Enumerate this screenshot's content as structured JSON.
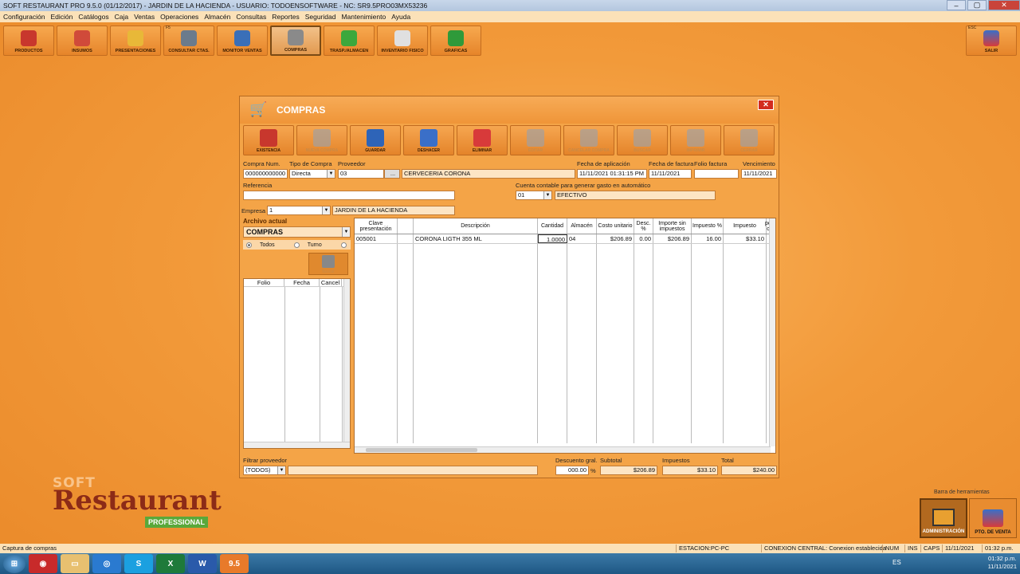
{
  "window": {
    "title": "SOFT RESTAURANT PRO 9.5.0 (01/12/2017)  -  JARDIN DE LA HACIENDA  -  USUARIO: TODOENSOFTWARE   -   NC: SR9.5PRO03MX53236"
  },
  "menu": [
    "Configuración",
    "Edición",
    "Catálogos",
    "Caja",
    "Ventas",
    "Operaciones",
    "Almacén",
    "Consultas",
    "Reportes",
    "Seguridad",
    "Mantenimiento",
    "Ayuda"
  ],
  "toolbar": [
    {
      "label": "PRODUCTOS",
      "icon": "products-icon",
      "color": "#c8372d"
    },
    {
      "label": "INSUMOS",
      "icon": "supplies-icon",
      "color": "#d04a3a"
    },
    {
      "label": "PRESENTACIONES",
      "icon": "beer-icon",
      "color": "#e8b838"
    },
    {
      "label": "CONSULTAR CTAS.",
      "icon": "phone-search-icon",
      "color": "#6b7b8c",
      "key": "F5"
    },
    {
      "label": "MONITOR VENTAS",
      "icon": "monitor-icon",
      "color": "#3a6fb8"
    },
    {
      "label": "COMPRAS",
      "icon": "cart-icon",
      "color": "#8a8a8a",
      "active": true
    },
    {
      "label": "TRASP./ALMACEN",
      "icon": "transfer-icon",
      "color": "#3ca83c"
    },
    {
      "label": "INVENTARIO FISICO",
      "icon": "clipboard-icon",
      "color": "#e0e0e0"
    },
    {
      "label": "GRAFICAS",
      "icon": "chart-icon",
      "color": "#2f9a3a"
    }
  ],
  "exit_button": {
    "label": "SALIR",
    "key": "ESC"
  },
  "dialog": {
    "title": "COMPRAS",
    "close": "✕",
    "tools": [
      {
        "label": "EXISTENCIA",
        "icon": "stock-icon",
        "color": "#c8372d",
        "disabled": false
      },
      {
        "label": "NUEVA COMPRA",
        "icon": "new-doc-icon",
        "disabled": true
      },
      {
        "label": "GUARDAR",
        "icon": "save-icon",
        "color": "#2e64b8",
        "disabled": false
      },
      {
        "label": "DESHACER",
        "icon": "undo-icon",
        "color": "#3a6fc8",
        "disabled": false
      },
      {
        "label": "ELIMINAR",
        "icon": "eraser-icon",
        "color": "#d83a3a",
        "disabled": false
      },
      {
        "label": "EDITAR",
        "icon": "pencil-icon",
        "disabled": true
      },
      {
        "label": "CANCELAR COMPRA",
        "icon": "cancel-icon",
        "disabled": true
      },
      {
        "label": "BUSCAR",
        "icon": "search-icon",
        "disabled": true
      },
      {
        "label": "IMPRIMIR",
        "icon": "printer-icon",
        "disabled": true
      },
      {
        "label": "CERRAR",
        "icon": "exit-door-icon",
        "disabled": true
      }
    ],
    "labels": {
      "compra_num": "Compra Num.",
      "tipo": "Tipo de Compra",
      "proveedor": "Proveedor",
      "fecha_aplicacion": "Fecha de aplicación",
      "fecha_factura": "Fecha de factura",
      "folio_factura": "Folio factura",
      "vencimiento": "Vencimiento",
      "referencia": "Referencia",
      "cuenta": "Cuenta contable para generar gasto en automático",
      "empresa": "Empresa",
      "archivo": "Archivo actual"
    },
    "values": {
      "compra_num": "000000000000",
      "tipo": "Directa",
      "proveedor_code": "03",
      "proveedor_btn": "...",
      "proveedor_name": "CERVECERIA CORONA",
      "fecha_aplicacion": "11/11/2021 01:31:15 PM",
      "fecha_factura": "11/11/2021",
      "folio_factura": "",
      "vencimiento": "11/11/2021",
      "referencia": "",
      "cuenta_code": "01",
      "cuenta_name": "EFECTIVO",
      "empresa_code": "1",
      "empresa_name": "JARDIN DE LA HACIENDA",
      "archivo": "COMPRAS"
    },
    "radios": [
      "Todos",
      "Turno",
      "Periodo"
    ],
    "buscar": "Buscar",
    "left_grid_headers": [
      "Folio",
      "Fecha",
      "Cancel"
    ],
    "grid_headers": [
      "Clave presentación",
      "",
      "Descripción",
      "Cantidad",
      "Almacén",
      "Costo unitario",
      "Desc. %",
      "Importe sin impuestos",
      "Impuesto %",
      "Impuesto",
      "por c/"
    ],
    "grid_rows": [
      [
        "005001",
        "",
        "CORONA LIGTH 355 ML",
        "1.0000",
        "04",
        "$206.89",
        "0.00",
        "$206.89",
        "16.00",
        "$33.10"
      ]
    ],
    "footer": {
      "filtrar_label": "Filtrar proveedor",
      "filtrar_value": "(TODOS)",
      "descuento_label": "Descuento gral.",
      "descuento_value": "000.00",
      "pct": "%",
      "subtotal_label": "Subtotal",
      "subtotal_value": "$206.89",
      "impuestos_label": "Impuestos",
      "impuestos_value": "$33.10",
      "total_label": "Total",
      "total_value": "$240.00"
    }
  },
  "branding": {
    "soft": "SOFT",
    "restaurant": "Restaurant",
    "professional": "PROFESSIONAL"
  },
  "barra": {
    "label": "Barra de herramientas",
    "admin": "ADMINISTRACIÓN",
    "pos": "PTO. DE VENTA"
  },
  "statusbar": {
    "left": "Captura de compras",
    "estacion": "ESTACION:PC-PC",
    "conexion": "CONEXION CENTRAL:  Conexion establecida",
    "num": "NUM",
    "ins": "INS",
    "caps": "CAPS",
    "date": "11/11/2021",
    "time": "01:32 p.m."
  },
  "taskbar": {
    "lang": "ES",
    "time": "01:32 p.m.",
    "date": "11/11/2021",
    "sr": "9.5"
  }
}
